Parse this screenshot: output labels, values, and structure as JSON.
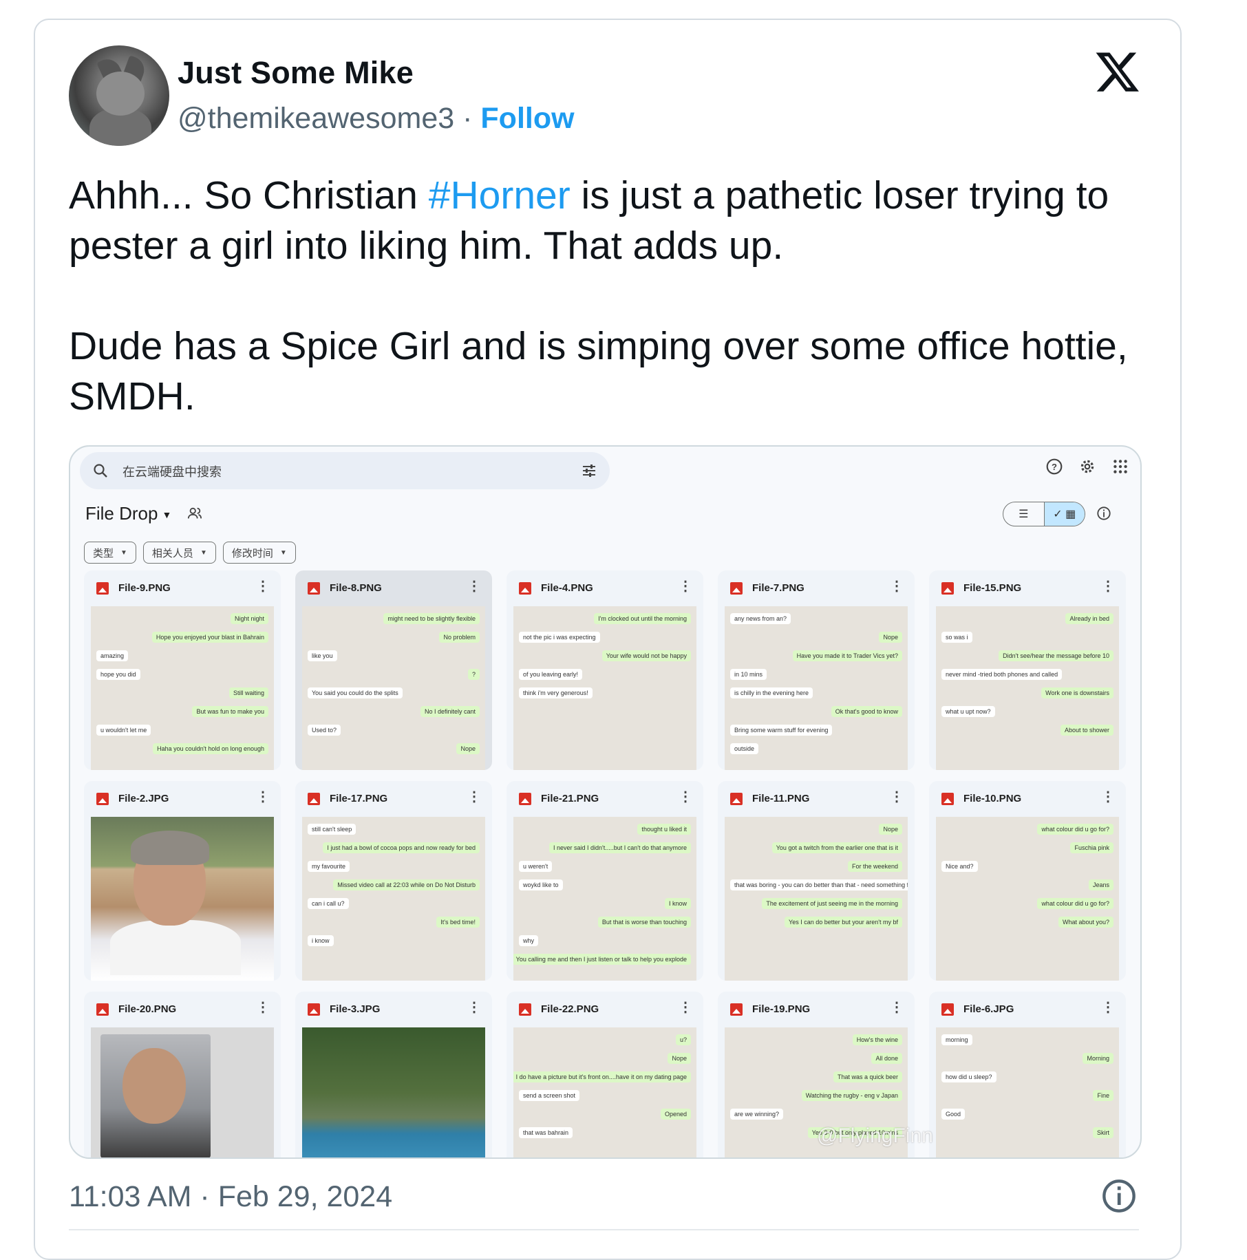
{
  "author": {
    "name": "Just Some Mike",
    "handle": "@themikeawesome3",
    "separator": "·",
    "follow_label": "Follow"
  },
  "tweet": {
    "line1_before": "Ahhh... So Christian ",
    "hashtag": "#Horner",
    "line1_after": " is just a pathetic loser trying to pester a girl into liking him. That adds up.",
    "para2": "Dude has a Spice Girl and is simping over some office hottie, SMDH.",
    "timestamp": "11:03 AM · Feb 29, 2024"
  },
  "drive": {
    "search_placeholder": "在云端硬盘中搜索",
    "folder_title": "File Drop",
    "filters": [
      "类型",
      "相关人员",
      "修改时间"
    ],
    "watermark": "@FlyingFinn",
    "files": [
      {
        "name": "File-9.PNG",
        "kind": "chat",
        "msgs": [
          [
            "out",
            "Night night"
          ],
          [
            "out",
            "Hope you enjoyed your blast in Bahrain"
          ],
          [
            "in",
            "amazing"
          ],
          [
            "in",
            "hope you did"
          ],
          [
            "out",
            "Still waiting"
          ],
          [
            "out",
            "But was fun to make you"
          ],
          [
            "in",
            "u wouldn't let me"
          ],
          [
            "out",
            "Haha you couldn't hold on long enough"
          ]
        ]
      },
      {
        "name": "File-8.PNG",
        "kind": "chat",
        "selected": true,
        "msgs": [
          [
            "out",
            "might need to be slightly flexible"
          ],
          [
            "out",
            "No problem"
          ],
          [
            "in",
            "like you"
          ],
          [
            "out",
            "?"
          ],
          [
            "in",
            "You said you could do the splits"
          ],
          [
            "out",
            "No I definitely cant"
          ],
          [
            "in",
            "Used to?"
          ],
          [
            "out",
            "Nope"
          ]
        ]
      },
      {
        "name": "File-4.PNG",
        "kind": "chat",
        "msgs": [
          [
            "out",
            "I'm clocked out until the morning"
          ],
          [
            "in",
            "not the pic i was expecting"
          ],
          [
            "out",
            "Your wife would not be happy"
          ],
          [
            "in",
            "of you leaving early!"
          ],
          [
            "in",
            "think i'm very generous!"
          ]
        ]
      },
      {
        "name": "File-7.PNG",
        "kind": "chat",
        "msgs": [
          [
            "in",
            "any news from an?"
          ],
          [
            "out",
            "Nope"
          ],
          [
            "out",
            "Have you made it to Trader Vics yet?"
          ],
          [
            "in",
            "in 10 mins"
          ],
          [
            "in",
            "is chilly in the evening here"
          ],
          [
            "out",
            "Ok that's good to know"
          ],
          [
            "in",
            "Bring some warm stuff for evening"
          ],
          [
            "in",
            "outside"
          ]
        ]
      },
      {
        "name": "File-15.PNG",
        "kind": "chat",
        "msgs": [
          [
            "out",
            "Already in bed"
          ],
          [
            "in",
            "so was i"
          ],
          [
            "out",
            "Didn't see/hear the message before 10"
          ],
          [
            "in",
            "never mind -tried both phones and called"
          ],
          [
            "out",
            "Work one is downstairs"
          ],
          [
            "in",
            "what u upt now?"
          ],
          [
            "out",
            "About to shower"
          ]
        ]
      },
      {
        "name": "File-2.JPG",
        "kind": "photo-horner"
      },
      {
        "name": "File-17.PNG",
        "kind": "chat",
        "msgs": [
          [
            "in",
            "still can't sleep"
          ],
          [
            "out",
            "I just had a bowl of cocoa pops and now ready for bed"
          ],
          [
            "in",
            "my favourite"
          ],
          [
            "out",
            "Missed video call at 22:03 while on Do Not Disturb"
          ],
          [
            "in",
            "can i call u?"
          ],
          [
            "out",
            "It's bed time!"
          ],
          [
            "in",
            "i know"
          ]
        ]
      },
      {
        "name": "File-21.PNG",
        "kind": "chat",
        "msgs": [
          [
            "out",
            "thought u liked it"
          ],
          [
            "out",
            "I never said I didn't.....but I can't do that anymore"
          ],
          [
            "in",
            "u weren't"
          ],
          [
            "in",
            "woykd like to"
          ],
          [
            "out",
            "I know"
          ],
          [
            "out",
            "But that is worse than touching"
          ],
          [
            "in",
            "why"
          ],
          [
            "out",
            "You calling me and then I just listen or talk to help you explode"
          ]
        ]
      },
      {
        "name": "File-11.PNG",
        "kind": "chat",
        "msgs": [
          [
            "out",
            "Nope"
          ],
          [
            "out",
            "You got a twitch from the earlier one that is it"
          ],
          [
            "out",
            "For the weekend"
          ],
          [
            "in",
            "that was boring - you can do better than that - need something for the trip back"
          ],
          [
            "out",
            "The excitement of just seeing me in the morning"
          ],
          [
            "out",
            "Yes I can do better but your aren't my bf"
          ]
        ]
      },
      {
        "name": "File-10.PNG",
        "kind": "chat",
        "msgs": [
          [
            "out",
            "what colour did u go for?"
          ],
          [
            "out",
            "Fuschia pink"
          ],
          [
            "in",
            "Nice and?"
          ],
          [
            "out",
            "Jeans"
          ],
          [
            "out",
            "what colour did u go for?"
          ],
          [
            "out",
            "What about you?"
          ]
        ]
      },
      {
        "name": "File-20.PNG",
        "kind": "photo-selfie"
      },
      {
        "name": "File-3.JPG",
        "kind": "photo-pool"
      },
      {
        "name": "File-22.PNG",
        "kind": "chat",
        "msgs": [
          [
            "out",
            "u?"
          ],
          [
            "out",
            "Nope"
          ],
          [
            "out",
            "I do have a picture but it's front on....have it on my dating page"
          ],
          [
            "in",
            "send a screen shot"
          ],
          [
            "out",
            "Opened"
          ],
          [
            "in",
            "that was bahrain"
          ]
        ]
      },
      {
        "name": "File-19.PNG",
        "kind": "chat",
        "msgs": [
          [
            "out",
            "How's the wine"
          ],
          [
            "out",
            "All done"
          ],
          [
            "out",
            "That was a quick beer"
          ],
          [
            "out",
            "Watching the rugby - eng v Japan"
          ],
          [
            "in",
            "are we winning?"
          ],
          [
            "out",
            "Yep 3-0 but only played 10mins"
          ]
        ]
      },
      {
        "name": "File-6.JPG",
        "kind": "chat",
        "msgs": [
          [
            "in",
            "morning"
          ],
          [
            "out",
            "Morning"
          ],
          [
            "in",
            "how did u sleep?"
          ],
          [
            "out",
            "Fine"
          ],
          [
            "in",
            "Good"
          ],
          [
            "out",
            "Skirt"
          ]
        ]
      }
    ]
  }
}
